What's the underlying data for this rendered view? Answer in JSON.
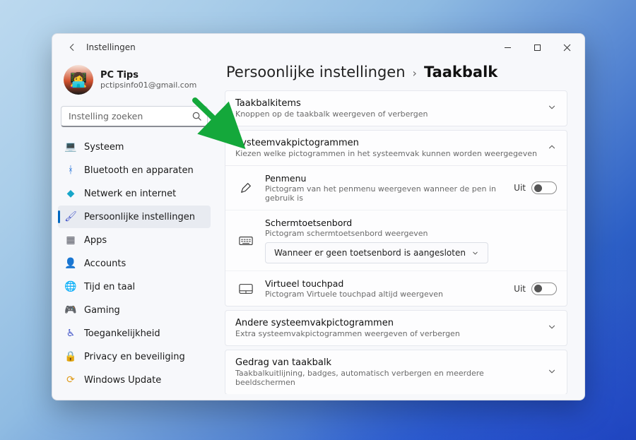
{
  "title": "Instellingen",
  "profile": {
    "name": "PC Tips",
    "email": "pctipsinfo01@gmail.com"
  },
  "search": {
    "placeholder": "Instelling zoeken"
  },
  "sidebar": {
    "items": [
      {
        "icon": "💻",
        "label": "Systeem",
        "cls": "g-blue"
      },
      {
        "icon": "ᚼ",
        "label": "Bluetooth en apparaten",
        "cls": "g-blue"
      },
      {
        "icon": "◆",
        "label": "Netwerk en internet",
        "cls": "g-cyan"
      },
      {
        "icon": "🖌",
        "label": "Persoonlijke instellingen",
        "cls": "g-indigo",
        "selected": true
      },
      {
        "icon": "▦",
        "label": "Apps",
        "cls": "g-grey"
      },
      {
        "icon": "👤",
        "label": "Accounts",
        "cls": "g-teal"
      },
      {
        "icon": "🌐",
        "label": "Tijd en taal",
        "cls": "g-grey"
      },
      {
        "icon": "🎮",
        "label": "Gaming",
        "cls": "g-green"
      },
      {
        "icon": "♿",
        "label": "Toegankelijkheid",
        "cls": "g-indigo"
      },
      {
        "icon": "🔒",
        "label": "Privacy en beveiliging",
        "cls": "g-grey"
      },
      {
        "icon": "⟳",
        "label": "Windows Update",
        "cls": "g-amber"
      }
    ]
  },
  "breadcrumb": {
    "parent": "Persoonlijke instellingen",
    "current": "Taakbalk"
  },
  "panels": {
    "items": [
      {
        "title": "Taakbalkitems",
        "sub": "Knoppen op de taakbalk weergeven of verbergen",
        "expanded": false
      },
      {
        "title": "Systeemvakpictogrammen",
        "sub": "Kiezen welke pictogrammen in het systeemvak kunnen worden weergegeven",
        "expanded": true,
        "rows": [
          {
            "icon": "pen",
            "title": "Penmenu",
            "sub": "Pictogram van het penmenu weergeven wanneer de pen in gebruik is",
            "toggle": {
              "label": "Uit",
              "on": false
            }
          },
          {
            "icon": "keyboard",
            "title": "Schermtoetsenbord",
            "sub": "Pictogram schermtoetsenbord weergeven",
            "dropdown": {
              "value": "Wanneer er geen toetsenbord is aangesloten"
            }
          },
          {
            "icon": "touchpad",
            "title": "Virtueel touchpad",
            "sub": "Pictogram Virtuele touchpad altijd weergeven",
            "toggle": {
              "label": "Uit",
              "on": false
            }
          }
        ]
      },
      {
        "title": "Andere systeemvakpictogrammen",
        "sub": "Extra systeemvakpictogrammen weergeven of verbergen",
        "expanded": false
      },
      {
        "title": "Gedrag van taakbalk",
        "sub": "Taakbalkuitlijning, badges, automatisch verbergen en meerdere beeldschermen",
        "expanded": false
      }
    ]
  }
}
